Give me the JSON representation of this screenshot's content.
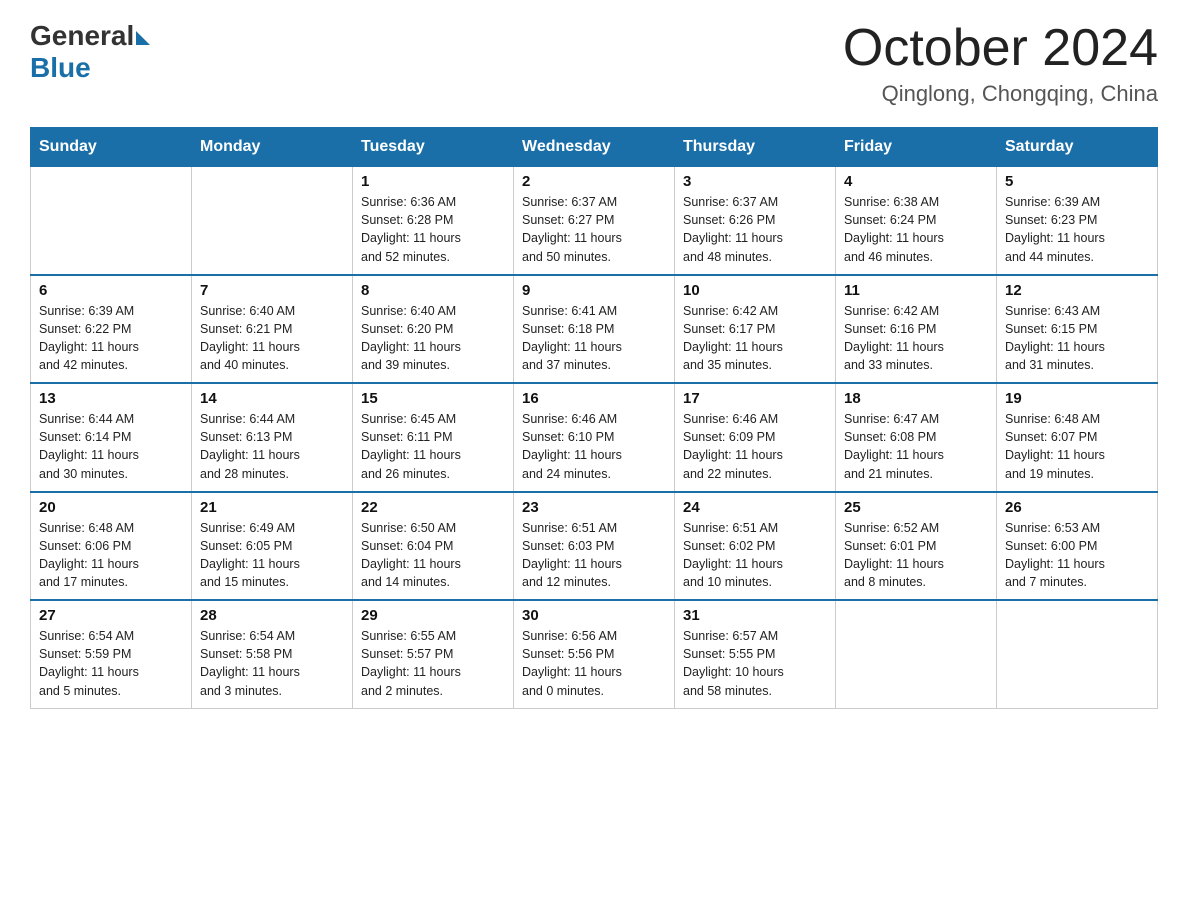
{
  "header": {
    "logo_general": "General",
    "logo_blue": "Blue",
    "month": "October 2024",
    "location": "Qinglong, Chongqing, China"
  },
  "days_of_week": [
    "Sunday",
    "Monday",
    "Tuesday",
    "Wednesday",
    "Thursday",
    "Friday",
    "Saturday"
  ],
  "weeks": [
    [
      {
        "day": "",
        "info": ""
      },
      {
        "day": "",
        "info": ""
      },
      {
        "day": "1",
        "info": "Sunrise: 6:36 AM\nSunset: 6:28 PM\nDaylight: 11 hours\nand 52 minutes."
      },
      {
        "day": "2",
        "info": "Sunrise: 6:37 AM\nSunset: 6:27 PM\nDaylight: 11 hours\nand 50 minutes."
      },
      {
        "day": "3",
        "info": "Sunrise: 6:37 AM\nSunset: 6:26 PM\nDaylight: 11 hours\nand 48 minutes."
      },
      {
        "day": "4",
        "info": "Sunrise: 6:38 AM\nSunset: 6:24 PM\nDaylight: 11 hours\nand 46 minutes."
      },
      {
        "day": "5",
        "info": "Sunrise: 6:39 AM\nSunset: 6:23 PM\nDaylight: 11 hours\nand 44 minutes."
      }
    ],
    [
      {
        "day": "6",
        "info": "Sunrise: 6:39 AM\nSunset: 6:22 PM\nDaylight: 11 hours\nand 42 minutes."
      },
      {
        "day": "7",
        "info": "Sunrise: 6:40 AM\nSunset: 6:21 PM\nDaylight: 11 hours\nand 40 minutes."
      },
      {
        "day": "8",
        "info": "Sunrise: 6:40 AM\nSunset: 6:20 PM\nDaylight: 11 hours\nand 39 minutes."
      },
      {
        "day": "9",
        "info": "Sunrise: 6:41 AM\nSunset: 6:18 PM\nDaylight: 11 hours\nand 37 minutes."
      },
      {
        "day": "10",
        "info": "Sunrise: 6:42 AM\nSunset: 6:17 PM\nDaylight: 11 hours\nand 35 minutes."
      },
      {
        "day": "11",
        "info": "Sunrise: 6:42 AM\nSunset: 6:16 PM\nDaylight: 11 hours\nand 33 minutes."
      },
      {
        "day": "12",
        "info": "Sunrise: 6:43 AM\nSunset: 6:15 PM\nDaylight: 11 hours\nand 31 minutes."
      }
    ],
    [
      {
        "day": "13",
        "info": "Sunrise: 6:44 AM\nSunset: 6:14 PM\nDaylight: 11 hours\nand 30 minutes."
      },
      {
        "day": "14",
        "info": "Sunrise: 6:44 AM\nSunset: 6:13 PM\nDaylight: 11 hours\nand 28 minutes."
      },
      {
        "day": "15",
        "info": "Sunrise: 6:45 AM\nSunset: 6:11 PM\nDaylight: 11 hours\nand 26 minutes."
      },
      {
        "day": "16",
        "info": "Sunrise: 6:46 AM\nSunset: 6:10 PM\nDaylight: 11 hours\nand 24 minutes."
      },
      {
        "day": "17",
        "info": "Sunrise: 6:46 AM\nSunset: 6:09 PM\nDaylight: 11 hours\nand 22 minutes."
      },
      {
        "day": "18",
        "info": "Sunrise: 6:47 AM\nSunset: 6:08 PM\nDaylight: 11 hours\nand 21 minutes."
      },
      {
        "day": "19",
        "info": "Sunrise: 6:48 AM\nSunset: 6:07 PM\nDaylight: 11 hours\nand 19 minutes."
      }
    ],
    [
      {
        "day": "20",
        "info": "Sunrise: 6:48 AM\nSunset: 6:06 PM\nDaylight: 11 hours\nand 17 minutes."
      },
      {
        "day": "21",
        "info": "Sunrise: 6:49 AM\nSunset: 6:05 PM\nDaylight: 11 hours\nand 15 minutes."
      },
      {
        "day": "22",
        "info": "Sunrise: 6:50 AM\nSunset: 6:04 PM\nDaylight: 11 hours\nand 14 minutes."
      },
      {
        "day": "23",
        "info": "Sunrise: 6:51 AM\nSunset: 6:03 PM\nDaylight: 11 hours\nand 12 minutes."
      },
      {
        "day": "24",
        "info": "Sunrise: 6:51 AM\nSunset: 6:02 PM\nDaylight: 11 hours\nand 10 minutes."
      },
      {
        "day": "25",
        "info": "Sunrise: 6:52 AM\nSunset: 6:01 PM\nDaylight: 11 hours\nand 8 minutes."
      },
      {
        "day": "26",
        "info": "Sunrise: 6:53 AM\nSunset: 6:00 PM\nDaylight: 11 hours\nand 7 minutes."
      }
    ],
    [
      {
        "day": "27",
        "info": "Sunrise: 6:54 AM\nSunset: 5:59 PM\nDaylight: 11 hours\nand 5 minutes."
      },
      {
        "day": "28",
        "info": "Sunrise: 6:54 AM\nSunset: 5:58 PM\nDaylight: 11 hours\nand 3 minutes."
      },
      {
        "day": "29",
        "info": "Sunrise: 6:55 AM\nSunset: 5:57 PM\nDaylight: 11 hours\nand 2 minutes."
      },
      {
        "day": "30",
        "info": "Sunrise: 6:56 AM\nSunset: 5:56 PM\nDaylight: 11 hours\nand 0 minutes."
      },
      {
        "day": "31",
        "info": "Sunrise: 6:57 AM\nSunset: 5:55 PM\nDaylight: 10 hours\nand 58 minutes."
      },
      {
        "day": "",
        "info": ""
      },
      {
        "day": "",
        "info": ""
      }
    ]
  ]
}
